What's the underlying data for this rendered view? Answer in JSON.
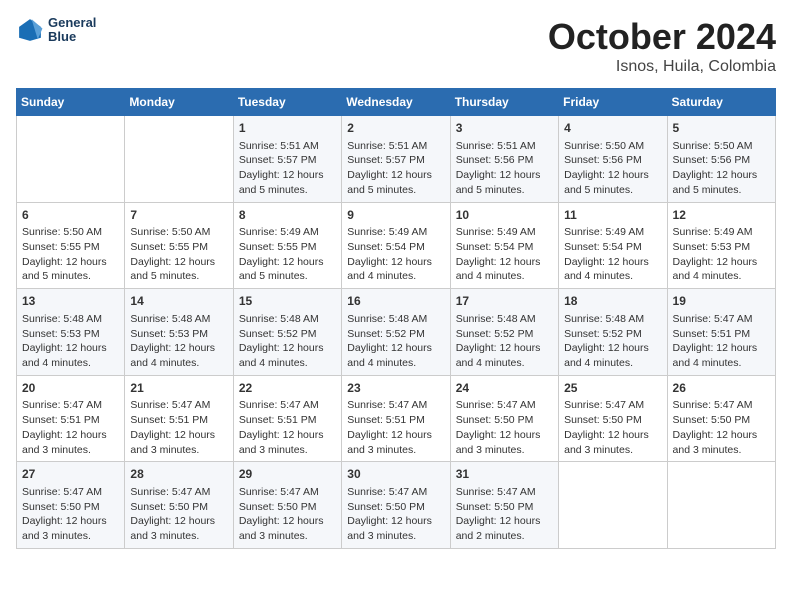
{
  "header": {
    "logo_line1": "General",
    "logo_line2": "Blue",
    "title": "October 2024",
    "subtitle": "Isnos, Huila, Colombia"
  },
  "columns": [
    "Sunday",
    "Monday",
    "Tuesday",
    "Wednesday",
    "Thursday",
    "Friday",
    "Saturday"
  ],
  "weeks": [
    [
      {
        "day": "",
        "lines": []
      },
      {
        "day": "",
        "lines": []
      },
      {
        "day": "1",
        "lines": [
          "Sunrise: 5:51 AM",
          "Sunset: 5:57 PM",
          "Daylight: 12 hours",
          "and 5 minutes."
        ]
      },
      {
        "day": "2",
        "lines": [
          "Sunrise: 5:51 AM",
          "Sunset: 5:57 PM",
          "Daylight: 12 hours",
          "and 5 minutes."
        ]
      },
      {
        "day": "3",
        "lines": [
          "Sunrise: 5:51 AM",
          "Sunset: 5:56 PM",
          "Daylight: 12 hours",
          "and 5 minutes."
        ]
      },
      {
        "day": "4",
        "lines": [
          "Sunrise: 5:50 AM",
          "Sunset: 5:56 PM",
          "Daylight: 12 hours",
          "and 5 minutes."
        ]
      },
      {
        "day": "5",
        "lines": [
          "Sunrise: 5:50 AM",
          "Sunset: 5:56 PM",
          "Daylight: 12 hours",
          "and 5 minutes."
        ]
      }
    ],
    [
      {
        "day": "6",
        "lines": [
          "Sunrise: 5:50 AM",
          "Sunset: 5:55 PM",
          "Daylight: 12 hours",
          "and 5 minutes."
        ]
      },
      {
        "day": "7",
        "lines": [
          "Sunrise: 5:50 AM",
          "Sunset: 5:55 PM",
          "Daylight: 12 hours",
          "and 5 minutes."
        ]
      },
      {
        "day": "8",
        "lines": [
          "Sunrise: 5:49 AM",
          "Sunset: 5:55 PM",
          "Daylight: 12 hours",
          "and 5 minutes."
        ]
      },
      {
        "day": "9",
        "lines": [
          "Sunrise: 5:49 AM",
          "Sunset: 5:54 PM",
          "Daylight: 12 hours",
          "and 4 minutes."
        ]
      },
      {
        "day": "10",
        "lines": [
          "Sunrise: 5:49 AM",
          "Sunset: 5:54 PM",
          "Daylight: 12 hours",
          "and 4 minutes."
        ]
      },
      {
        "day": "11",
        "lines": [
          "Sunrise: 5:49 AM",
          "Sunset: 5:54 PM",
          "Daylight: 12 hours",
          "and 4 minutes."
        ]
      },
      {
        "day": "12",
        "lines": [
          "Sunrise: 5:49 AM",
          "Sunset: 5:53 PM",
          "Daylight: 12 hours",
          "and 4 minutes."
        ]
      }
    ],
    [
      {
        "day": "13",
        "lines": [
          "Sunrise: 5:48 AM",
          "Sunset: 5:53 PM",
          "Daylight: 12 hours",
          "and 4 minutes."
        ]
      },
      {
        "day": "14",
        "lines": [
          "Sunrise: 5:48 AM",
          "Sunset: 5:53 PM",
          "Daylight: 12 hours",
          "and 4 minutes."
        ]
      },
      {
        "day": "15",
        "lines": [
          "Sunrise: 5:48 AM",
          "Sunset: 5:52 PM",
          "Daylight: 12 hours",
          "and 4 minutes."
        ]
      },
      {
        "day": "16",
        "lines": [
          "Sunrise: 5:48 AM",
          "Sunset: 5:52 PM",
          "Daylight: 12 hours",
          "and 4 minutes."
        ]
      },
      {
        "day": "17",
        "lines": [
          "Sunrise: 5:48 AM",
          "Sunset: 5:52 PM",
          "Daylight: 12 hours",
          "and 4 minutes."
        ]
      },
      {
        "day": "18",
        "lines": [
          "Sunrise: 5:48 AM",
          "Sunset: 5:52 PM",
          "Daylight: 12 hours",
          "and 4 minutes."
        ]
      },
      {
        "day": "19",
        "lines": [
          "Sunrise: 5:47 AM",
          "Sunset: 5:51 PM",
          "Daylight: 12 hours",
          "and 4 minutes."
        ]
      }
    ],
    [
      {
        "day": "20",
        "lines": [
          "Sunrise: 5:47 AM",
          "Sunset: 5:51 PM",
          "Daylight: 12 hours",
          "and 3 minutes."
        ]
      },
      {
        "day": "21",
        "lines": [
          "Sunrise: 5:47 AM",
          "Sunset: 5:51 PM",
          "Daylight: 12 hours",
          "and 3 minutes."
        ]
      },
      {
        "day": "22",
        "lines": [
          "Sunrise: 5:47 AM",
          "Sunset: 5:51 PM",
          "Daylight: 12 hours",
          "and 3 minutes."
        ]
      },
      {
        "day": "23",
        "lines": [
          "Sunrise: 5:47 AM",
          "Sunset: 5:51 PM",
          "Daylight: 12 hours",
          "and 3 minutes."
        ]
      },
      {
        "day": "24",
        "lines": [
          "Sunrise: 5:47 AM",
          "Sunset: 5:50 PM",
          "Daylight: 12 hours",
          "and 3 minutes."
        ]
      },
      {
        "day": "25",
        "lines": [
          "Sunrise: 5:47 AM",
          "Sunset: 5:50 PM",
          "Daylight: 12 hours",
          "and 3 minutes."
        ]
      },
      {
        "day": "26",
        "lines": [
          "Sunrise: 5:47 AM",
          "Sunset: 5:50 PM",
          "Daylight: 12 hours",
          "and 3 minutes."
        ]
      }
    ],
    [
      {
        "day": "27",
        "lines": [
          "Sunrise: 5:47 AM",
          "Sunset: 5:50 PM",
          "Daylight: 12 hours",
          "and 3 minutes."
        ]
      },
      {
        "day": "28",
        "lines": [
          "Sunrise: 5:47 AM",
          "Sunset: 5:50 PM",
          "Daylight: 12 hours",
          "and 3 minutes."
        ]
      },
      {
        "day": "29",
        "lines": [
          "Sunrise: 5:47 AM",
          "Sunset: 5:50 PM",
          "Daylight: 12 hours",
          "and 3 minutes."
        ]
      },
      {
        "day": "30",
        "lines": [
          "Sunrise: 5:47 AM",
          "Sunset: 5:50 PM",
          "Daylight: 12 hours",
          "and 3 minutes."
        ]
      },
      {
        "day": "31",
        "lines": [
          "Sunrise: 5:47 AM",
          "Sunset: 5:50 PM",
          "Daylight: 12 hours",
          "and 2 minutes."
        ]
      },
      {
        "day": "",
        "lines": []
      },
      {
        "day": "",
        "lines": []
      }
    ]
  ]
}
